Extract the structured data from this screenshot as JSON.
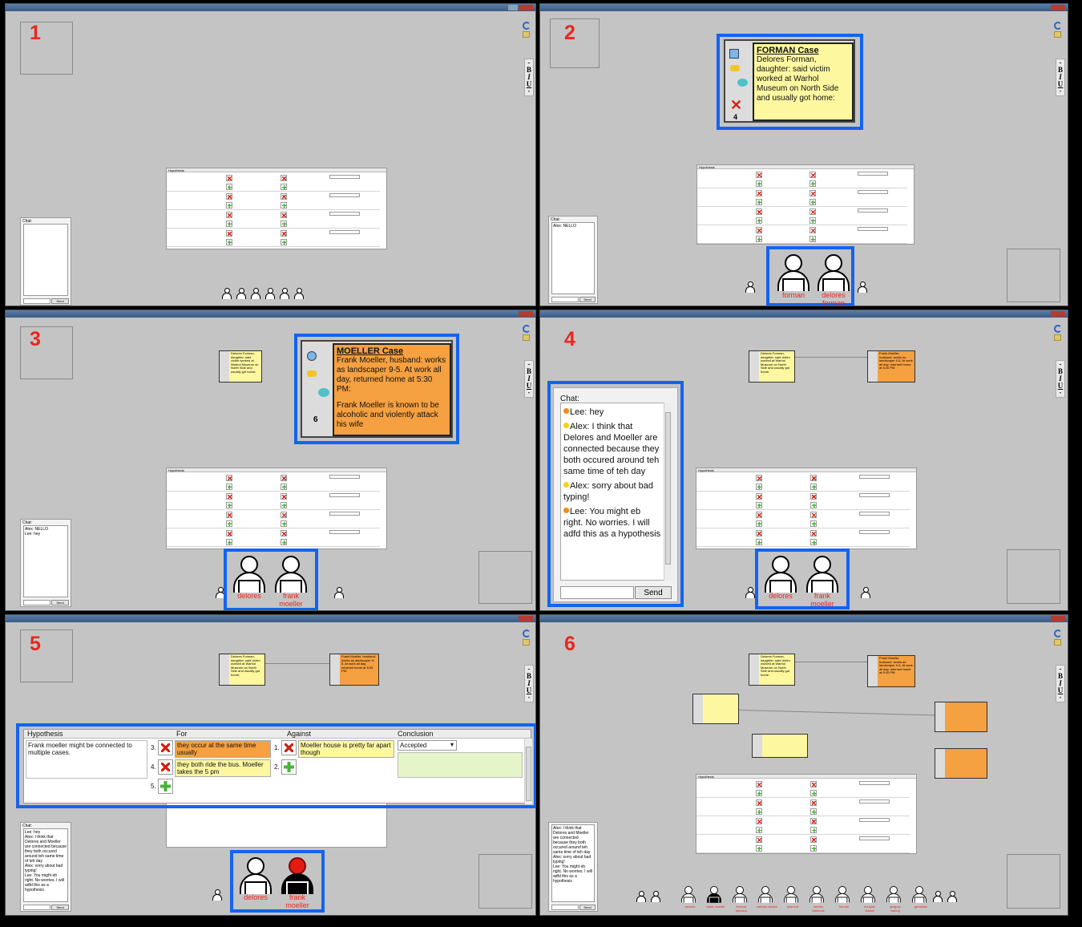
{
  "panels": [
    {
      "number": "1"
    },
    {
      "number": "2",
      "card": {
        "title": "FORMAN Case",
        "text": " Delores Forman, daughter: said victim worked at Warhol Museum on North Side and usually got home:",
        "count": "4"
      },
      "chat": [
        "Alex: NELLO"
      ],
      "people": [
        {
          "name": "forman"
        },
        {
          "name": "delores forman"
        }
      ]
    },
    {
      "number": "3",
      "card": {
        "title": "MOELLER Case",
        "text": " Frank Moeller, husband: works as landscaper 9-5. At work all day, returned home at 5:30 PM:",
        "text2": "Frank Moeller is known to be alcoholic and violently attack his wife",
        "count": "6"
      },
      "chat": [
        "Alex: NELLO",
        "Lee: hey"
      ],
      "people": [
        {
          "name": "delores"
        },
        {
          "name": "frank moeller"
        }
      ]
    },
    {
      "number": "4",
      "chat": {
        "label": "Chat:",
        "messages": [
          {
            "text": "Lee: hey",
            "color": "#f08b1c"
          },
          {
            "text": "Alex: I think that Delores and Moeller are connected because they both occured around teh same time of teh day",
            "color": "#f5d21a"
          },
          {
            "text": "Alex: sorry about bad typing!",
            "color": "#f5d21a"
          },
          {
            "text": "Lee: You might eb right. No worries. I will adfd this as a hypothesis",
            "color": "#f08b1c"
          }
        ],
        "send": "Send"
      },
      "people": [
        {
          "name": "delores"
        },
        {
          "name": "frank moeller"
        }
      ]
    },
    {
      "number": "5",
      "table": {
        "headers": [
          "Hypothesis",
          "For",
          "Against",
          "Conclusion"
        ],
        "hypothesis": "Frank moeller might be connected to multiple cases.",
        "for": [
          {
            "n": "3.",
            "text": "they occur at the same time usually"
          },
          {
            "n": "4.",
            "text": "they both ride the bus. Moeller takes the 5 pm"
          },
          {
            "n": "5."
          }
        ],
        "against": [
          {
            "n": "1.",
            "text": "Moeller house is pretty far apart though"
          },
          {
            "n": "2."
          }
        ],
        "conclusion": "Accepted"
      },
      "people": [
        {
          "name": "delores"
        },
        {
          "name": "frank moeller"
        }
      ]
    },
    {
      "number": "6",
      "names": [
        "delores",
        "frank moeller",
        "thomas johnson",
        "kathryn stokes",
        "julia tuft",
        "dennis lattbrook",
        "forman",
        "douglas folwell",
        "gregory waring",
        "geraldine"
      ]
    }
  ],
  "mini": {
    "send": "Send",
    "chat_label": "Chat:",
    "headers": [
      "Hypothesis",
      "For",
      "Against",
      "Conclusion"
    ]
  }
}
